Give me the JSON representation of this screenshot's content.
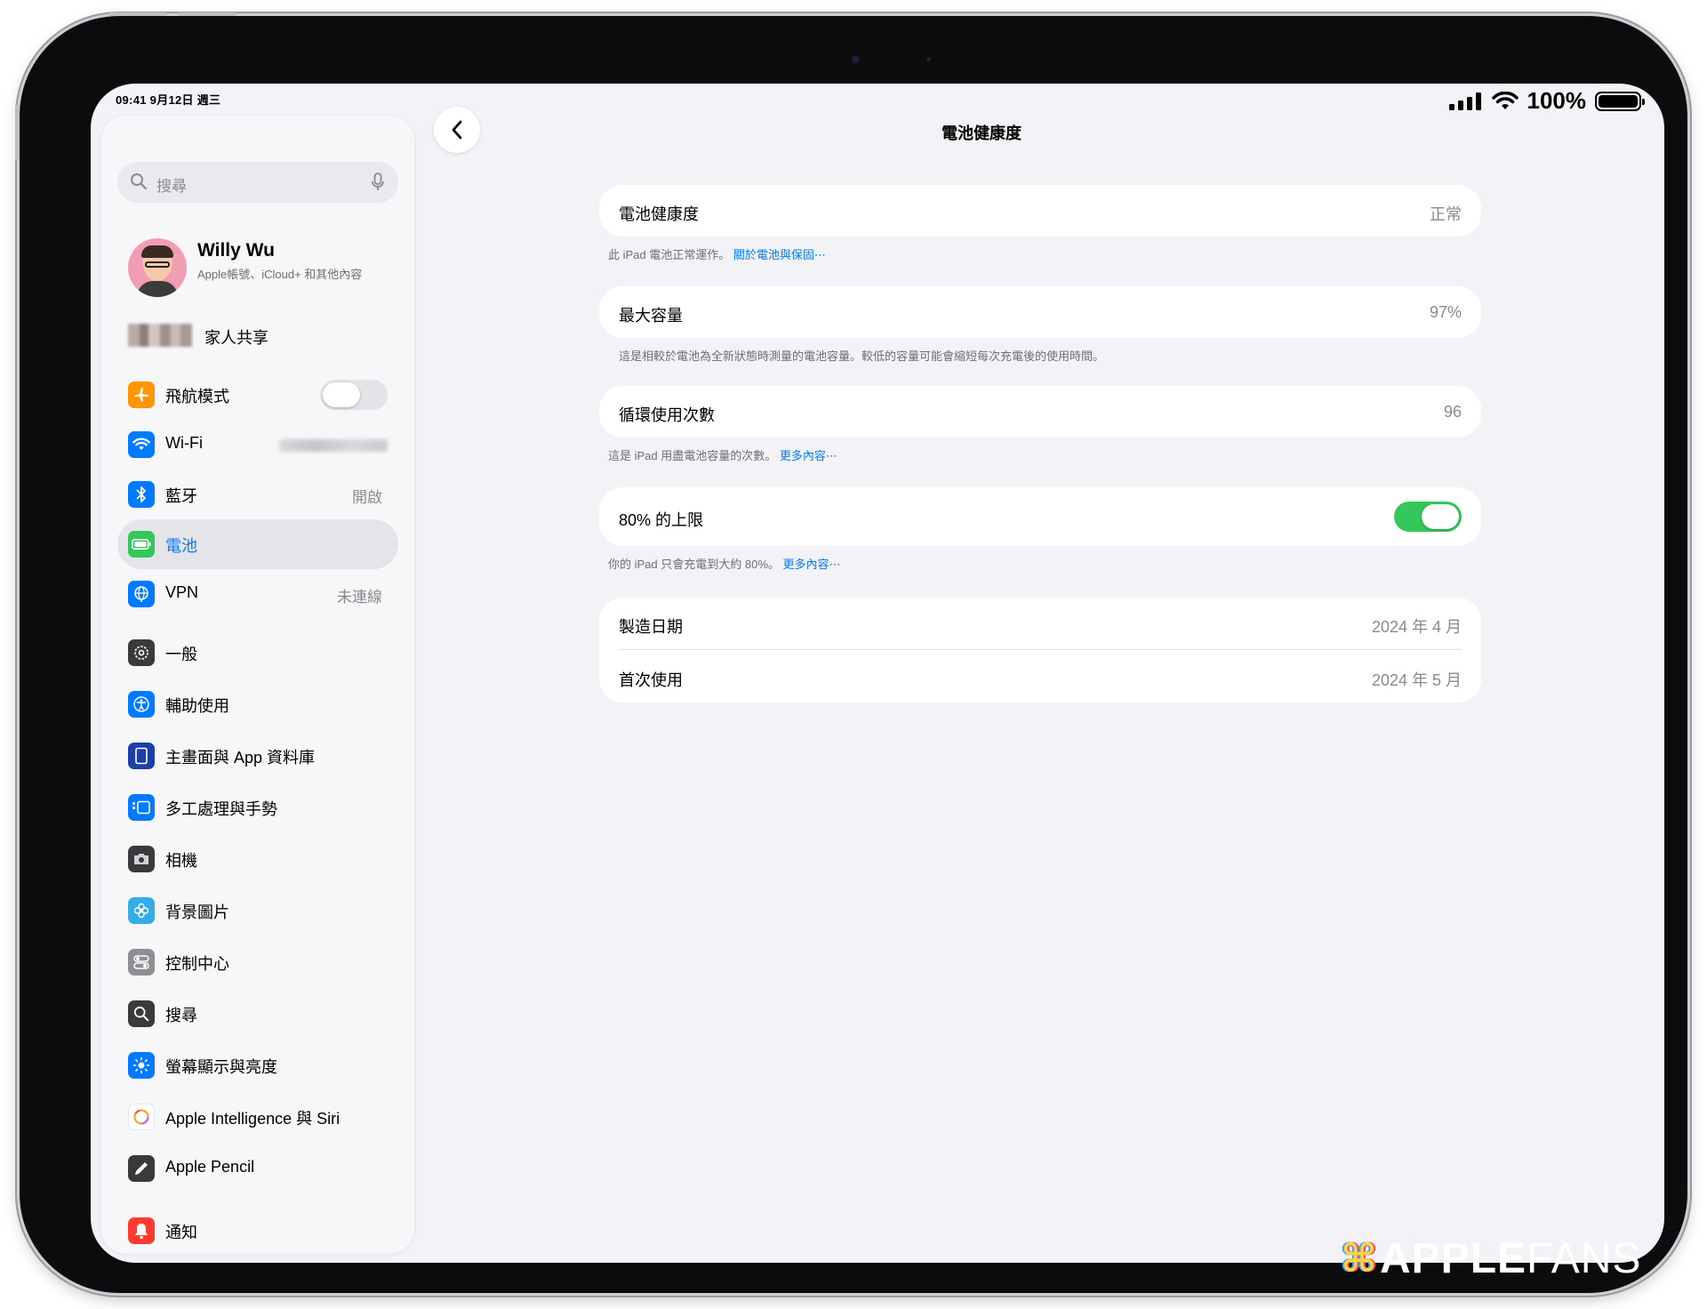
{
  "status_bar": {
    "time_date": "09:41  9月12日 週三",
    "battery_percent": "100%"
  },
  "sidebar": {
    "search_placeholder": "搜尋",
    "profile": {
      "name": "Willy Wu",
      "subtitle": "Apple帳號、iCloud+ 和其他內容"
    },
    "family_sharing": "家人共享",
    "group1": [
      {
        "label": "飛航模式",
        "icon": "airplane-icon",
        "color": "#ff9500",
        "toggle": false
      },
      {
        "label": "Wi-Fi",
        "icon": "wifi-icon",
        "color": "#007aff"
      },
      {
        "label": "藍牙",
        "icon": "bluetooth-icon",
        "color": "#007aff",
        "value": "開啟"
      },
      {
        "label": "電池",
        "icon": "battery-icon",
        "color": "#34c759",
        "selected": true
      },
      {
        "label": "VPN",
        "icon": "globe-icon",
        "color": "#007aff",
        "value": "未連線"
      }
    ],
    "group2": [
      {
        "label": "一般",
        "icon": "gear-icon",
        "color": "#3a3a3c"
      },
      {
        "label": "輔助使用",
        "icon": "accessibility-icon",
        "color": "#007aff"
      },
      {
        "label": "主畫面與 App 資料庫",
        "icon": "home-screen-icon",
        "color": "#1c3fa8"
      },
      {
        "label": "多工處理與手勢",
        "icon": "multitasking-icon",
        "color": "#007aff"
      },
      {
        "label": "相機",
        "icon": "camera-icon",
        "color": "#3a3a3c"
      },
      {
        "label": "背景圖片",
        "icon": "wallpaper-flower-icon",
        "color": "#32ade6"
      },
      {
        "label": "控制中心",
        "icon": "control-center-icon",
        "color": "#8e8e93"
      },
      {
        "label": "搜尋",
        "icon": "search-icon",
        "color": "#3a3a3c"
      },
      {
        "label": "螢幕顯示與亮度",
        "icon": "brightness-icon",
        "color": "#007aff"
      },
      {
        "label": "Apple Intelligence 與 Siri",
        "icon": "apple-intelligence-icon",
        "color": "#ffffff"
      },
      {
        "label": "Apple Pencil",
        "icon": "pencil-icon",
        "color": "#3a3a3c"
      },
      {
        "label": "通知",
        "icon": "bell-icon",
        "color": "#ff3b30"
      }
    ]
  },
  "main": {
    "title": "電池健康度",
    "health": {
      "label": "電池健康度",
      "value": "正常"
    },
    "health_footer": {
      "text": "此 iPad 電池正常運作。",
      "link": "關於電池與保固⋯"
    },
    "capacity": {
      "label": "最大容量",
      "value": "97%"
    },
    "capacity_footer": "這是相較於電池為全新狀態時測量的電池容量。較低的容量可能會縮短每次充電後的使用時間。",
    "cycles": {
      "label": "循環使用次數",
      "value": "96"
    },
    "cycles_footer": {
      "text": "這是 iPad 用盡電池容量的次數。",
      "link": "更多內容⋯"
    },
    "limit": {
      "label": "80% 的上限",
      "toggle": true
    },
    "limit_footer": {
      "text": "你的 iPad 只會充電到大約 80%。",
      "link": "更多內容⋯"
    },
    "manufacture": {
      "label": "製造日期",
      "value": "2024 年 4 月"
    },
    "first_use": {
      "label": "首次使用",
      "value": "2024 年 5 月"
    }
  },
  "watermark": {
    "bold": "APPLE",
    "thin": "FANS"
  }
}
